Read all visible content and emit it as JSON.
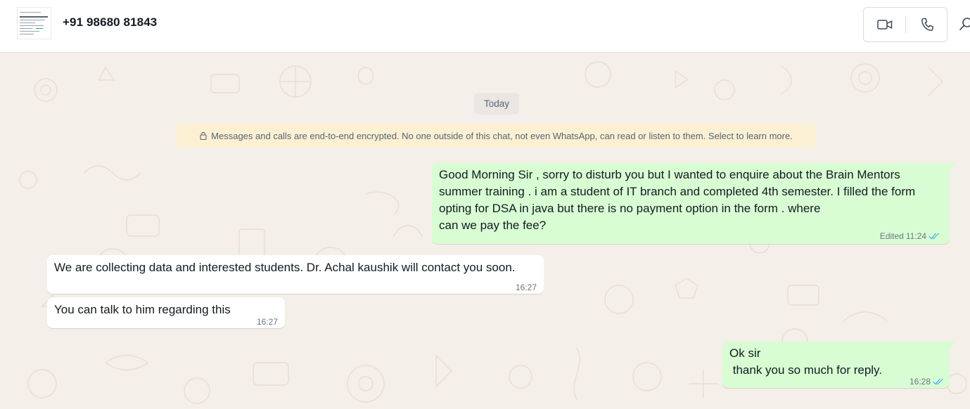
{
  "header": {
    "contact_name": "+91 98680 81843"
  },
  "icons": {
    "video_call": "video-camera-icon",
    "voice_call": "phone-icon",
    "search": "search-icon",
    "lock": "lock-icon",
    "read_receipt": "double-check-icon"
  },
  "colors": {
    "outgoing_bubble": "#d9fdd3",
    "incoming_bubble": "#ffffff",
    "chat_background": "#f4efe9",
    "banner_background": "#fcf0d3",
    "read_tick": "#53bdeb"
  },
  "chat": {
    "date_label": "Today",
    "encryption_notice": "Messages and calls are end-to-end encrypted. No one outside of this chat, not even WhatsApp, can read or listen to them. Select to learn more.",
    "messages": [
      {
        "direction": "outgoing",
        "text": "Good Morning Sir , sorry to disturb you but I wanted to enquire about the Brain Mentors\nsummer training . i am a student of IT branch and completed 4th semester. I filled the form\nopting for DSA in java but there is no payment option in the form . where\ncan we pay the fee?",
        "edited_label": "Edited",
        "time": "11:24",
        "status": "read"
      },
      {
        "direction": "incoming",
        "text": "We are collecting data and interested students. Dr. Achal kaushik will contact you soon.",
        "time": "16:27"
      },
      {
        "direction": "incoming",
        "text": "You can talk to him regarding this",
        "time": "16:27"
      },
      {
        "direction": "outgoing",
        "text": "Ok sir\n thank you so much for reply.",
        "time": "16:28",
        "status": "read"
      }
    ]
  }
}
